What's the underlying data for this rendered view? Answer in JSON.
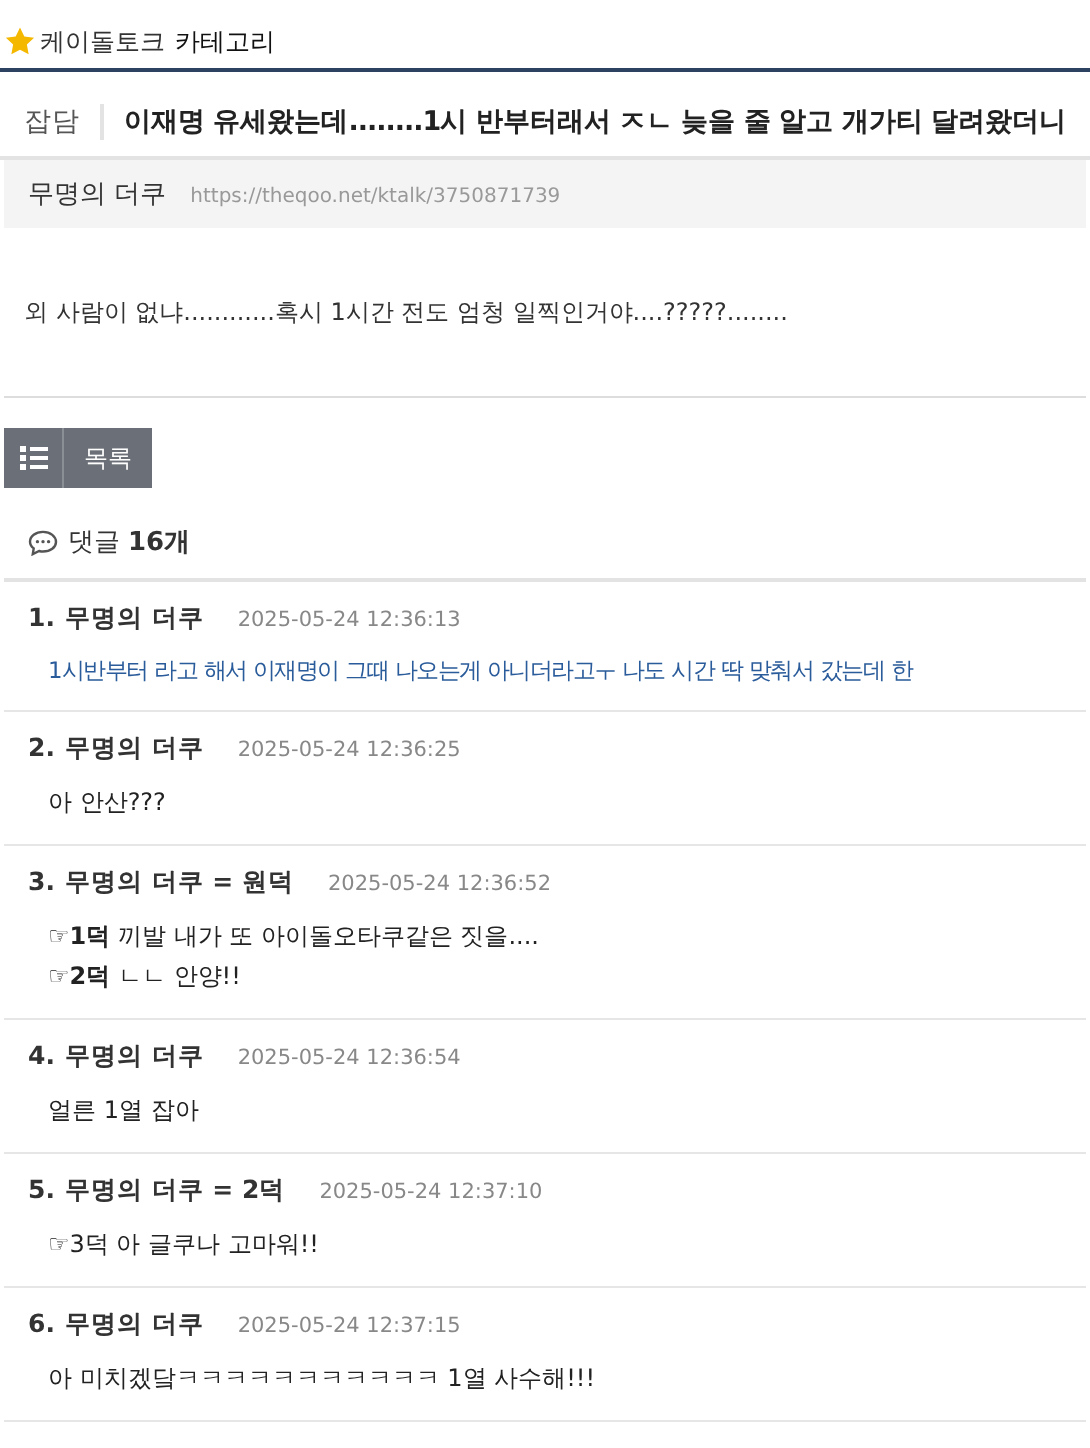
{
  "category": {
    "prefix": "케이돌토크",
    "label": "카테고리"
  },
  "post": {
    "tag": "잡담",
    "title": "이재명 유세왔는데........1시 반부터래서 ㅈㄴ 늦을 줄 알고 개가티 달려왔더니",
    "author": "무명의 더쿠",
    "url": "https://theqoo.net/ktalk/3750871739",
    "body": "외 사람이 없냐............혹시 1시간 전도 엄청 일찍인거야....?????........"
  },
  "list_button": {
    "label": "목록"
  },
  "comments_header": {
    "label": "댓글",
    "count": "16개"
  },
  "comments": [
    {
      "number": "1.",
      "author": "무명의 더쿠",
      "date": "2025-05-24 12:36:13",
      "linked": true,
      "lines": [
        "1시반부터 라고 해서 이재명이 그때 나오는게 아니더라고ㅜ 나도 시간 딱 맞춰서 갔는데 한"
      ]
    },
    {
      "number": "2.",
      "author": "무명의 더쿠",
      "date": "2025-05-24 12:36:25",
      "linked": false,
      "lines": [
        "아 안산???"
      ]
    },
    {
      "number": "3.",
      "author": "무명의 더쿠 = 원덕",
      "date": "2025-05-24 12:36:52",
      "linked": false,
      "lines": [
        "☞**1덕** 끼발 내가 또 아이돌오타쿠같은 짓을....",
        "☞**2덕** ㄴㄴ 안양!!"
      ]
    },
    {
      "number": "4.",
      "author": "무명의 더쿠",
      "date": "2025-05-24 12:36:54",
      "linked": false,
      "lines": [
        "얼른 1열 잡아"
      ]
    },
    {
      "number": "5.",
      "author": "무명의 더쿠 = 2덕",
      "date": "2025-05-24 12:37:10",
      "linked": false,
      "lines": [
        "☞3덕 아 글쿠나 고마워!!"
      ]
    },
    {
      "number": "6.",
      "author": "무명의 더쿠",
      "date": "2025-05-24 12:37:15",
      "linked": false,
      "lines": [
        "아 미치겠닼ㅋㅋㅋㅋㅋㅋㅋㅋㅋㅋㅋ 1열 사수해!!!"
      ]
    }
  ]
}
